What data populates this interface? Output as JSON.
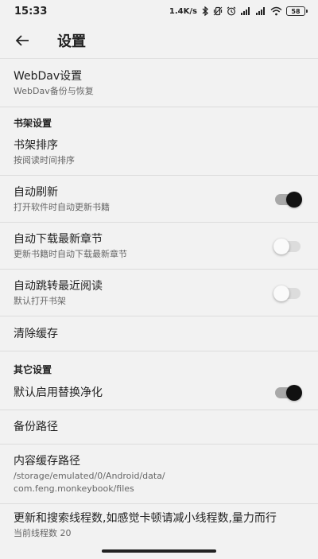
{
  "status_bar": {
    "time": "15:33",
    "net_speed": "1.4K/s",
    "battery": "58"
  },
  "app_bar": {
    "title": "设置",
    "back_icon": "arrow-back-icon"
  },
  "rows": {
    "webdav": {
      "title": "WebDav设置",
      "subtitle": "WebDav备份与恢复"
    },
    "section_bookshelf": "书架设置",
    "sort": {
      "title": "书架排序",
      "subtitle": "按阅读时间排序"
    },
    "auto_refresh": {
      "title": "自动刷新",
      "subtitle": "打开软件时自动更新书籍",
      "on": true
    },
    "auto_download": {
      "title": "自动下载最新章节",
      "subtitle": "更新书籍时自动下载最新章节",
      "on": false
    },
    "auto_jump": {
      "title": "自动跳转最近阅读",
      "subtitle": "默认打开书架",
      "on": false
    },
    "clear_cache": {
      "title": "清除缓存"
    },
    "section_other": "其它设置",
    "replace_purify": {
      "title": "默认启用替换净化",
      "on": true
    },
    "backup_path": {
      "title": "备份路径"
    },
    "cache_path": {
      "title": "内容缓存路径",
      "subtitle_line1": "/storage/emulated/0/Android/data/",
      "subtitle_line2": "com.feng.monkeybook/files"
    },
    "threads": {
      "title": "更新和搜索线程数,如感觉卡顿请减小线程数,量力而行",
      "subtitle": "当前线程数 20"
    }
  }
}
